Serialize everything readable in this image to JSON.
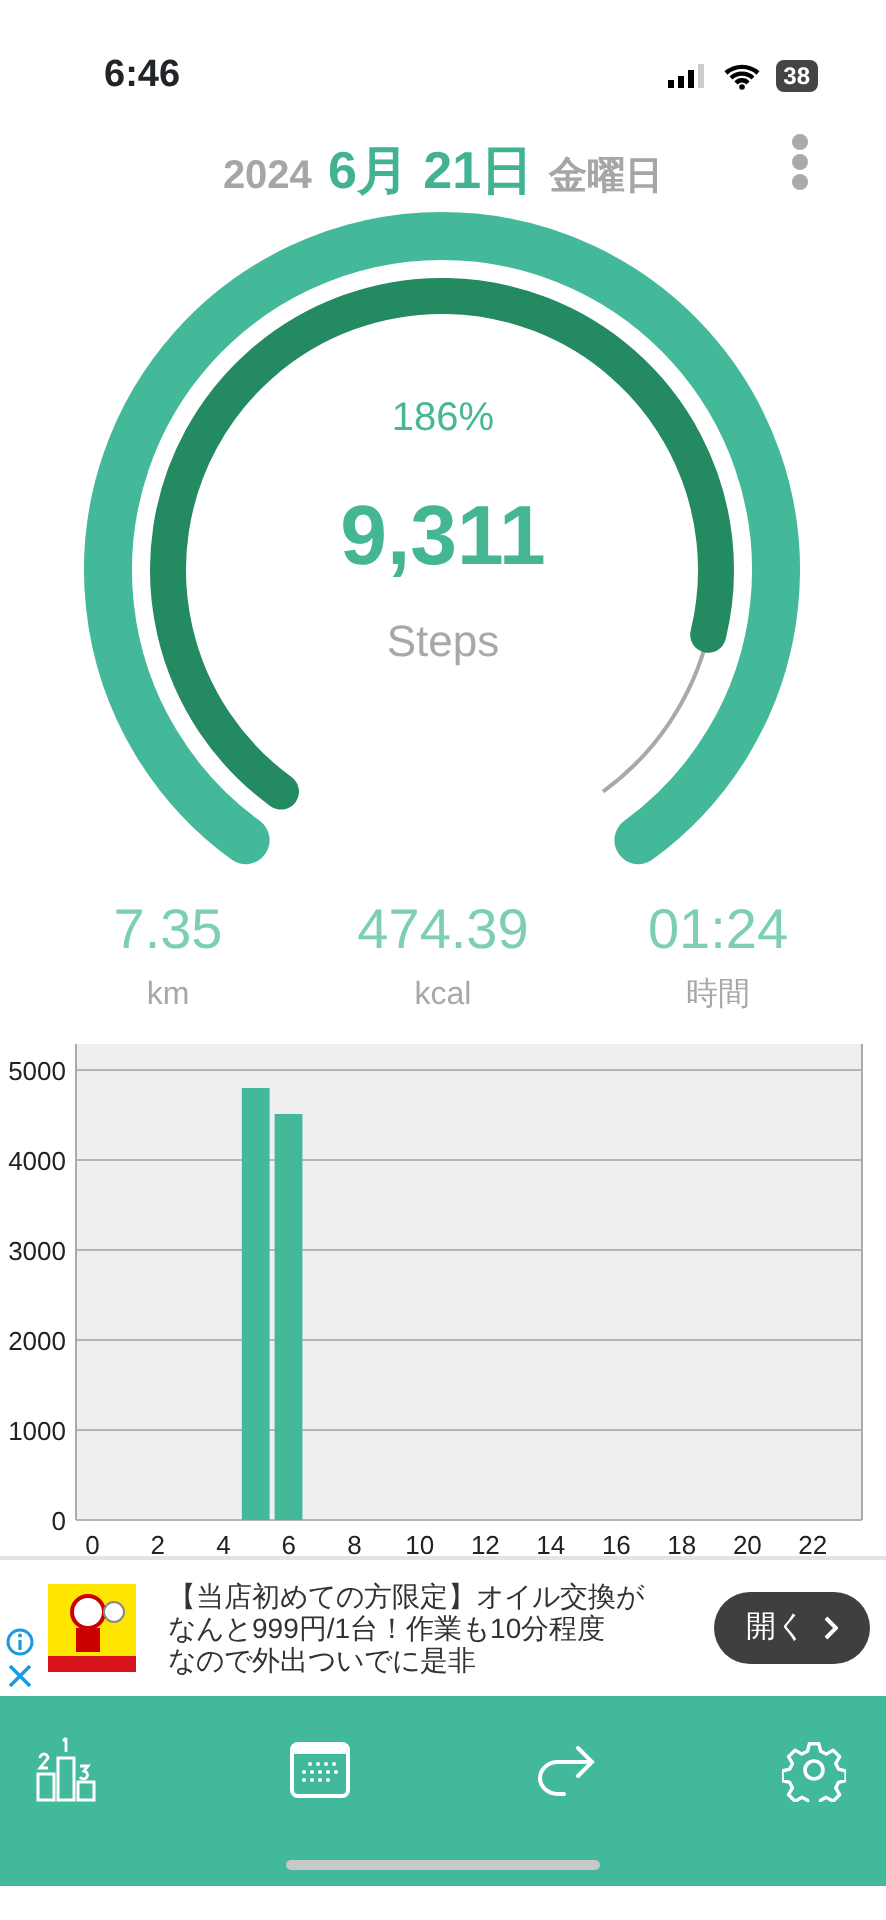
{
  "status_bar": {
    "time": "6:46",
    "battery": "38"
  },
  "header": {
    "year": "2024",
    "date": "6月 21日",
    "weekday": "金曜日"
  },
  "gauge": {
    "percent": "186%",
    "steps": "9,311",
    "unit": "Steps"
  },
  "stats": [
    {
      "value": "7.35",
      "unit": "km"
    },
    {
      "value": "474.39",
      "unit": "kcal"
    },
    {
      "value": "01:24",
      "unit": "時間"
    }
  ],
  "chart_data": {
    "type": "bar",
    "grid": true,
    "x": [
      5,
      6
    ],
    "series": [
      {
        "color": "#43b99a",
        "values": [
          4800,
          4510
        ]
      }
    ],
    "xlim": [
      -0.5,
      23.5
    ],
    "ylim": [
      0,
      5000
    ],
    "yticks": [
      0,
      1000,
      2000,
      3000,
      4000,
      5000
    ],
    "xticks": [
      0,
      2,
      4,
      6,
      8,
      10,
      12,
      14,
      16,
      18,
      20,
      22
    ]
  },
  "ad": {
    "text_lines": [
      "【当店初めての方限定】オイル交換が",
      "なんと999円/1台！作業も10分程度",
      "なので外出ついでに是非"
    ],
    "button": "開く"
  },
  "tabbar": [
    {
      "kind": "ranking"
    },
    {
      "kind": "calendar"
    },
    {
      "kind": "share"
    },
    {
      "kind": "settings"
    }
  ]
}
